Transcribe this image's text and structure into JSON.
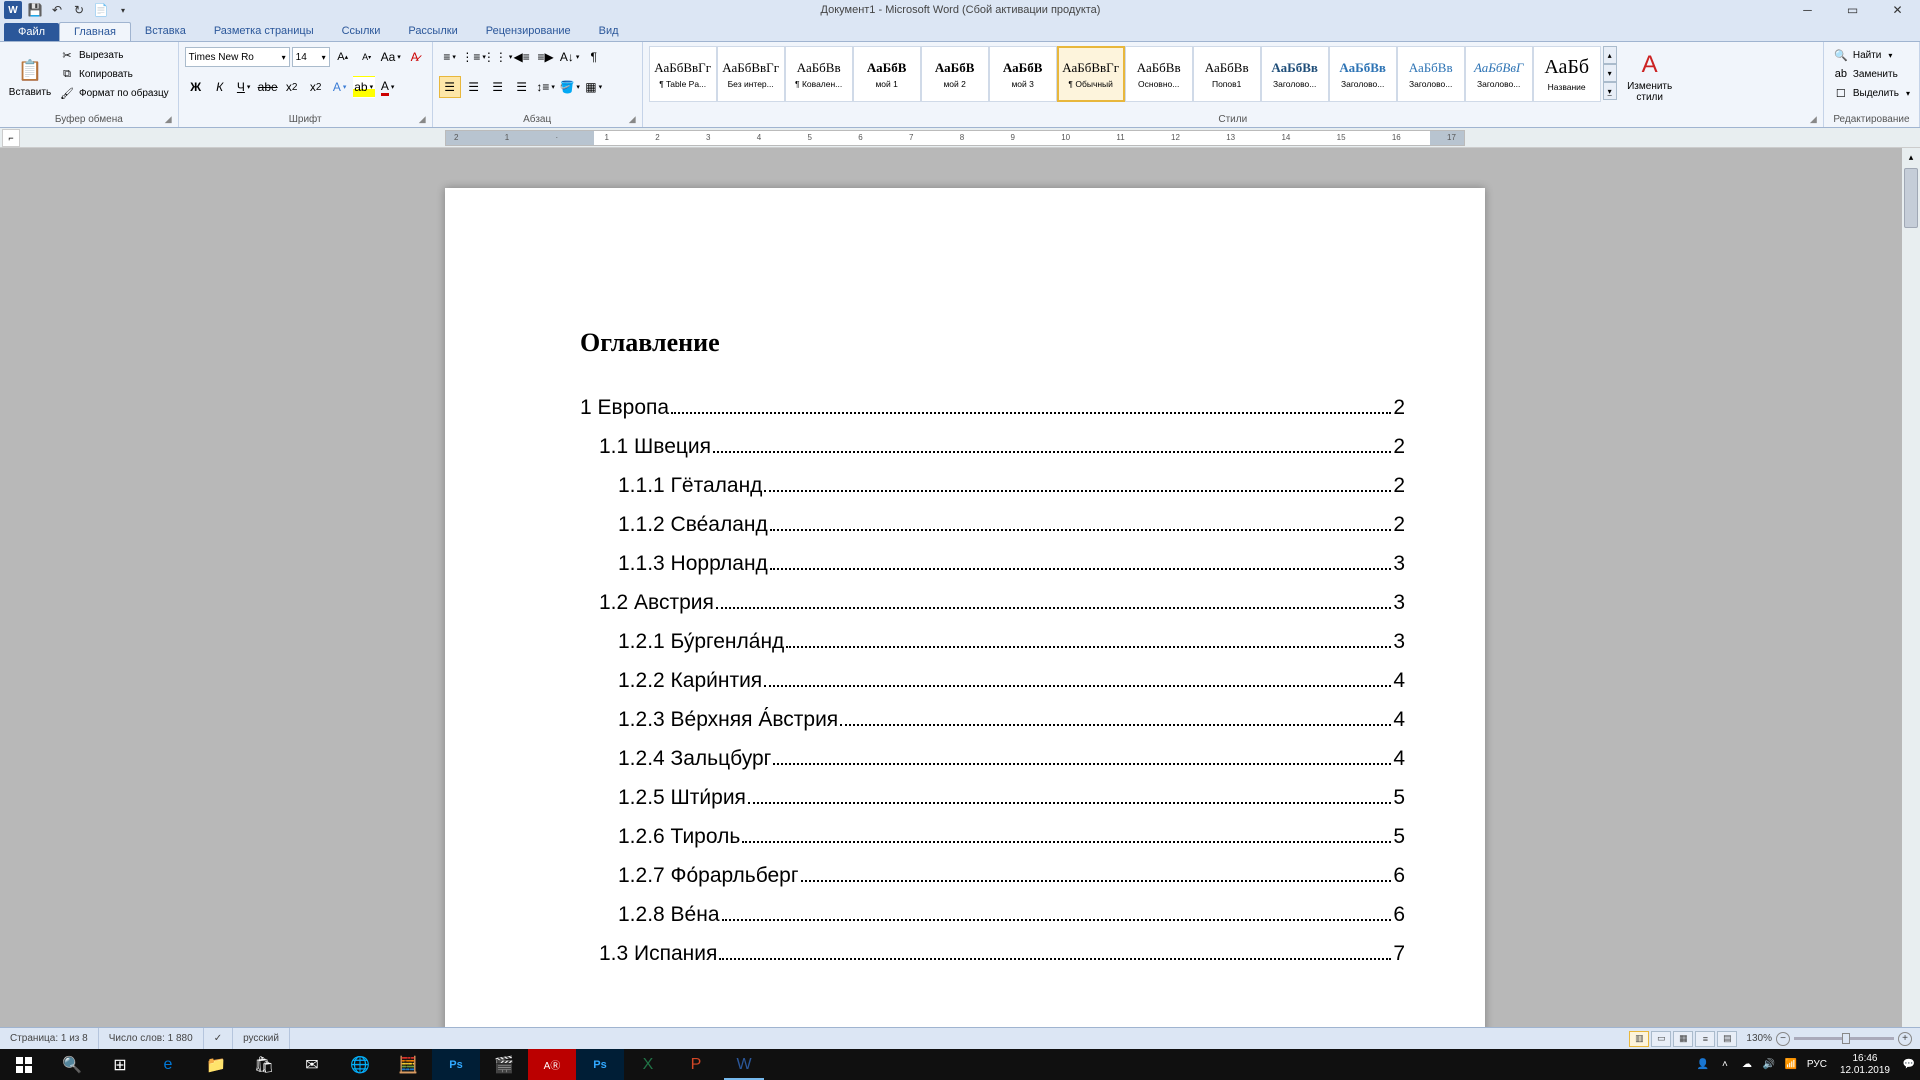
{
  "title": "Документ1 - Microsoft Word (Сбой активации продукта)",
  "qat": {
    "save": "💾",
    "undo": "↶",
    "redo": "↻",
    "new": "📄"
  },
  "tabs": {
    "file": "Файл",
    "items": [
      "Главная",
      "Вставка",
      "Разметка страницы",
      "Ссылки",
      "Рассылки",
      "Рецензирование",
      "Вид"
    ],
    "active": 0
  },
  "ribbon": {
    "clipboard": {
      "label": "Буфер обмена",
      "paste": "Вставить",
      "cut": "Вырезать",
      "copy": "Копировать",
      "format_painter": "Формат по образцу"
    },
    "font": {
      "label": "Шрифт",
      "name": "Times New Ro",
      "size": "14"
    },
    "paragraph": {
      "label": "Абзац"
    },
    "styles": {
      "label": "Стили",
      "change": "Изменить стили",
      "items": [
        {
          "preview": "АаБбВвГг",
          "name": "¶ Table Pa..."
        },
        {
          "preview": "АаБбВвГг",
          "name": "Без интер..."
        },
        {
          "preview": "АаБбВв",
          "name": "¶ Ковален..."
        },
        {
          "preview": "АаБбВ",
          "name": "мой 1",
          "bold": true
        },
        {
          "preview": "АаБбВ",
          "name": "мой 2",
          "bold": true
        },
        {
          "preview": "АаБбВ",
          "name": "мой 3",
          "bold": true
        },
        {
          "preview": "АаБбВвГг",
          "name": "¶ Обычный",
          "selected": true
        },
        {
          "preview": "АаБбВв",
          "name": "Основно..."
        },
        {
          "preview": "АаБбВв",
          "name": "Попов1"
        },
        {
          "preview": "АаБбВв",
          "name": "Заголово...",
          "color": "#1f4e79",
          "bold": true
        },
        {
          "preview": "АаБбВв",
          "name": "Заголово...",
          "color": "#2e74b5",
          "bold": true
        },
        {
          "preview": "АаБбВв",
          "name": "Заголово...",
          "color": "#2e74b5"
        },
        {
          "preview": "АаБбВвГ",
          "name": "Заголово...",
          "color": "#2e74b5",
          "italic": true
        },
        {
          "preview": "АаБб",
          "name": "Название",
          "big": true
        }
      ]
    },
    "editing": {
      "label": "Редактирование",
      "find": "Найти",
      "replace": "Заменить",
      "select": "Выделить"
    }
  },
  "document": {
    "toc_title": "Оглавление",
    "entries": [
      {
        "level": 1,
        "text": "1 Европа",
        "page": "2"
      },
      {
        "level": 2,
        "text": "1.1 Швеция",
        "page": "2"
      },
      {
        "level": 3,
        "text": "1.1.1 Гёталанд",
        "page": "2"
      },
      {
        "level": 3,
        "text": "1.1.2 Све́аланд",
        "page": "2"
      },
      {
        "level": 3,
        "text": "1.1.3 Норрланд",
        "page": "3"
      },
      {
        "level": 2,
        "text": "1.2 Австрия",
        "page": "3"
      },
      {
        "level": 3,
        "text": "1.2.1 Бу́ргенла́нд",
        "page": "3"
      },
      {
        "level": 3,
        "text": "1.2.2 Кари́нтия",
        "page": "4"
      },
      {
        "level": 3,
        "text": "1.2.3 Ве́рхняя А́встрия",
        "page": "4"
      },
      {
        "level": 3,
        "text": "1.2.4 Зальцбург",
        "page": "4"
      },
      {
        "level": 3,
        "text": "1.2.5 Шти́рия",
        "page": "5"
      },
      {
        "level": 3,
        "text": "1.2.6 Тироль",
        "page": "5"
      },
      {
        "level": 3,
        "text": "1.2.7 Фо́рарльберг",
        "page": "6"
      },
      {
        "level": 3,
        "text": "1.2.8 Ве́на",
        "page": "6"
      },
      {
        "level": 2,
        "text": "1.3 Испания",
        "page": "7"
      }
    ]
  },
  "statusbar": {
    "page": "Страница: 1 из 8",
    "words": "Число слов: 1 880",
    "lang": "русский",
    "zoom": "130%"
  },
  "tray": {
    "lang": "РУС",
    "time": "16:46",
    "date": "12.01.2019"
  }
}
